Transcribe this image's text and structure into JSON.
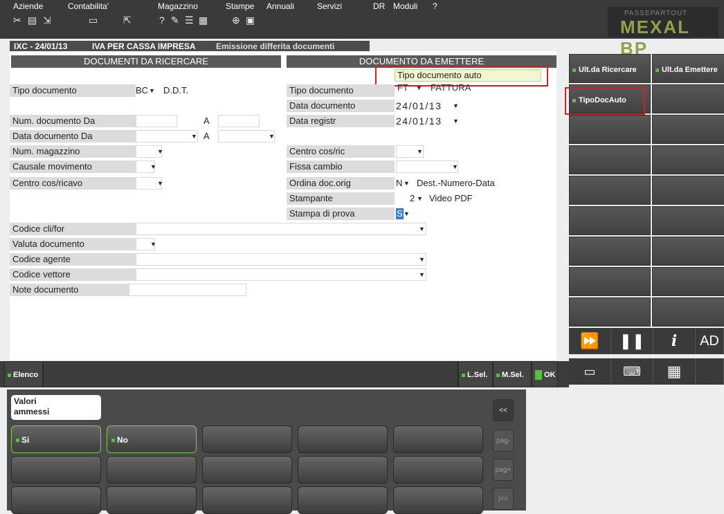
{
  "menu": [
    {
      "label": "Aziende",
      "ul": "A"
    },
    {
      "label": "Contabilita'",
      "ul": "C"
    },
    {
      "label": "Magazzino",
      "ul": "M"
    },
    {
      "label": "Stampe",
      "ul": "S"
    },
    {
      "label": "Annuali",
      "ul": "n"
    },
    {
      "label": "Servizi",
      "ul": "i"
    },
    {
      "label": "DR",
      "ul": "R"
    },
    {
      "label": "Moduli",
      "ul": ""
    },
    {
      "label": "?",
      "ul": ""
    }
  ],
  "toolbar_icons": [
    "scissors-icon",
    "document-icon",
    "shortcut-icon",
    "printer-icon",
    "export-icon",
    "help-icon",
    "calculator-icon",
    "calendar-icon",
    "expand-icon",
    "terminal-icon"
  ],
  "brand": {
    "small": "PASSEPARTOUT",
    "big": "MEXAL BP"
  },
  "titlebar": {
    "company": "IXC - 24/01/13",
    "module": "IVA PER CASSA IMPRESA",
    "screen": "Emissione differita documenti"
  },
  "left_section": {
    "title": "DOCUMENTI DA RICERCARE",
    "tipo_documento": {
      "label": "Tipo documento",
      "code": "BC",
      "desc": "D.D.T."
    },
    "num_documento": {
      "label": "Num. documento Da",
      "a_label": "A",
      "from": "",
      "to": ""
    },
    "data_documento": {
      "label": "Data documento Da",
      "a_label": "A",
      "from": "",
      "to": ""
    },
    "num_magazzino": {
      "label": "Num. magazzino",
      "value": ""
    },
    "causale_movimento": {
      "label": "Causale movimento",
      "value": ""
    },
    "centro_cos_ricavo": {
      "label": "Centro cos/ricavo",
      "value": ""
    },
    "codice_cli_for": {
      "label": "Codice cli/for",
      "value": ""
    },
    "valuta_documento": {
      "label": "Valuta documento",
      "value": ""
    },
    "codice_agente": {
      "label": "Codice agente",
      "value": ""
    },
    "codice_vettore": {
      "label": "Codice vettore",
      "value": ""
    },
    "note_documento": {
      "label": "Note documento",
      "value": ""
    }
  },
  "right_section": {
    "title": "DOCUMENTO DA EMETTERE",
    "tipo_documento_auto": {
      "label": "Tipo documento auto",
      "value": ""
    },
    "tipo_documento": {
      "label": "Tipo documento",
      "code": "FT",
      "desc": "FATTURA"
    },
    "data_documento": {
      "label": "Data documento",
      "value": "24/01/13"
    },
    "data_registr": {
      "label": "Data registr",
      "value": "24/01/13"
    },
    "centro_cos_ric": {
      "label": "Centro cos/ric",
      "value": ""
    },
    "fissa_cambio": {
      "label": "Fissa cambio",
      "value": ""
    },
    "ordina_doc_orig": {
      "label": "Ordina doc.orig",
      "code": "N",
      "desc": "Dest.-Numero-Data"
    },
    "stampante": {
      "label": "Stampante",
      "code": "2",
      "desc": "Video PDF"
    },
    "stampa_di_prova": {
      "label": "Stampa di prova",
      "value": "S"
    }
  },
  "side_buttons": [
    {
      "label": "Ult.da Ricercare"
    },
    {
      "label": "Ult.da Emettere"
    },
    {
      "label": "TipoDocAuto"
    }
  ],
  "side_icons": [
    "fast-forward-icon",
    "pause-icon",
    "info-icon"
  ],
  "side_icon_text": "AD",
  "side_icons_row2": [
    "keyboard-small-icon",
    "keyboard-icon",
    "grid-icon"
  ],
  "bottom_bar": {
    "elenco": "Elenco",
    "lsel": "L.Sel.",
    "msel": "M.Sel.",
    "ok": "OK"
  },
  "values_panel": {
    "title_line1": "Valori",
    "title_line2": "ammessi",
    "options": [
      "Si",
      "No"
    ],
    "nav": [
      "<<",
      "pag-",
      "pag+",
      "|<<"
    ]
  }
}
